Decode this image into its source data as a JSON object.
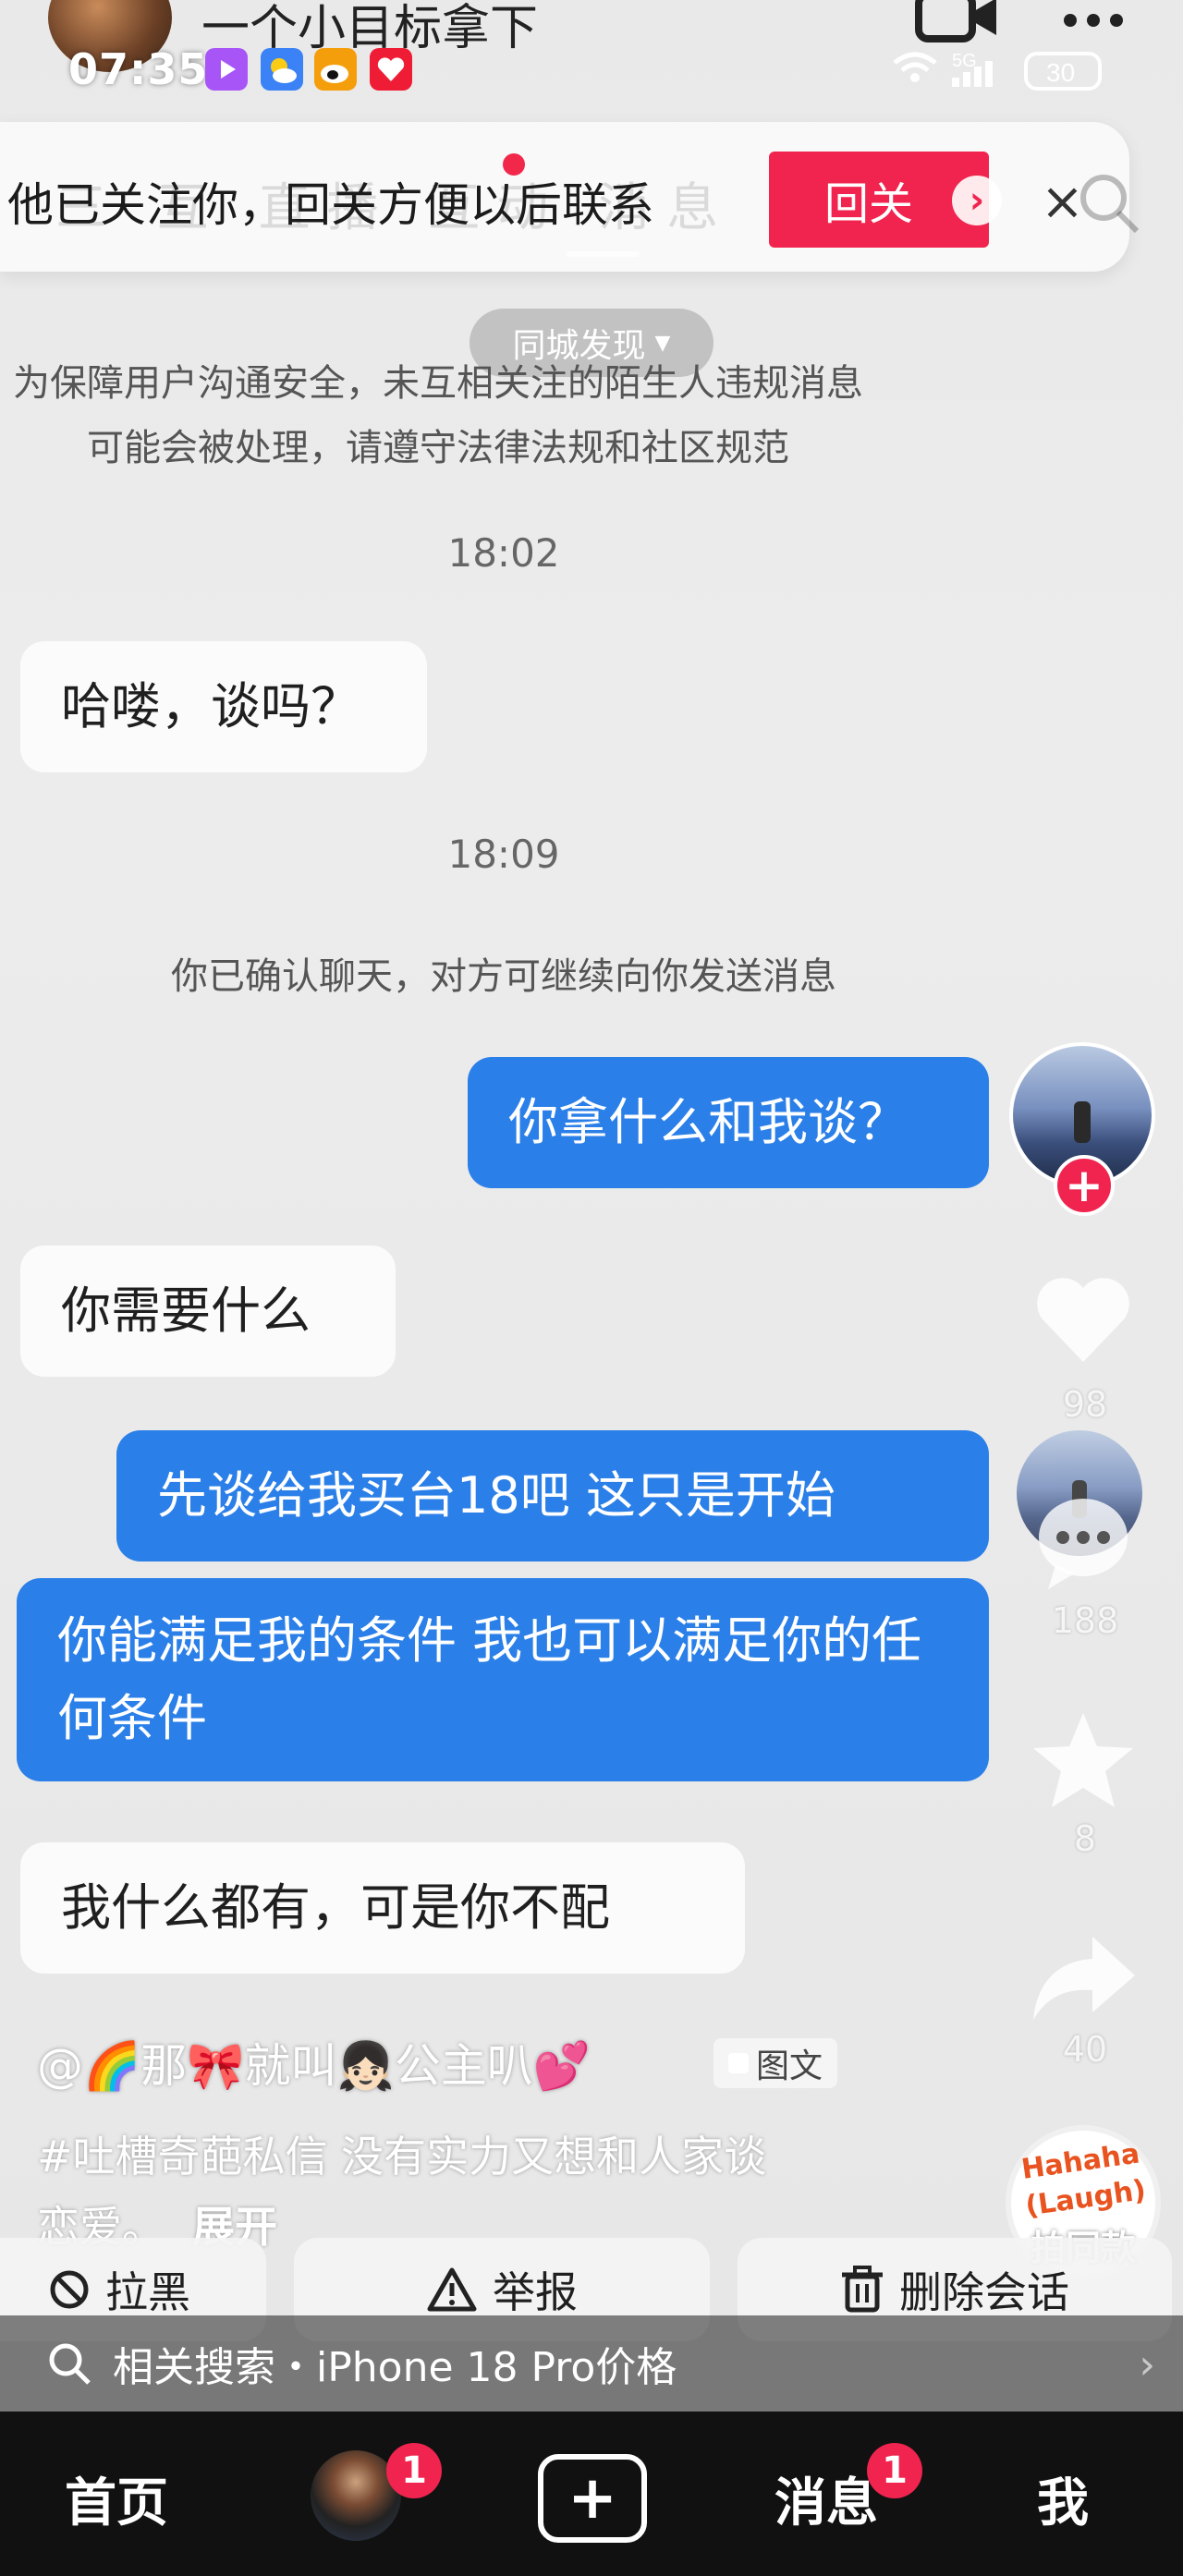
{
  "header": {
    "name": "一个小目标拿下",
    "video_icon": "video-camera-icon",
    "more_icon": "more-dots-icon"
  },
  "status_bar": {
    "time": "07:35",
    "network": "5G",
    "battery": "30",
    "apps": [
      {
        "icon": "video-app-icon",
        "color": "#a855f7"
      },
      {
        "icon": "weather-app-icon",
        "color": "#3b82f6"
      },
      {
        "icon": "weibo-icon",
        "color": "#f59e0b"
      },
      {
        "icon": "taobao-icon",
        "color": "#ef1c35"
      }
    ]
  },
  "banner": {
    "ghost_tabs": "三 互  直播  互动  消息  关注",
    "text": "他已关注你，回关方便以后联系",
    "follow_back_label": "回关",
    "arrow": "›",
    "close": "×"
  },
  "city_discover": "同城发现",
  "notice": "为保障用户沟通安全，未互相关注的陌生人违规消息可能会被处理，请遵守法律法规和社区规范",
  "times": {
    "t1": "18:02",
    "t2": "18:09"
  },
  "system_message": "你已确认聊天，对方可继续向你发送消息",
  "messages": [
    {
      "side": "in",
      "text": "哈喽，谈吗？"
    },
    {
      "side": "out",
      "text": "你拿什么和我谈？"
    },
    {
      "side": "in",
      "text": "你需要什么"
    },
    {
      "side": "out",
      "text": "先谈给我买台18吧 这只是开始"
    },
    {
      "side": "out",
      "text": "你能满足我的条件 我也可以满足你的任何条件"
    },
    {
      "side": "in",
      "text": "我什么都有，可是你不配"
    }
  ],
  "sidebar": {
    "likes": "98",
    "comments": "188",
    "favorites": "8",
    "shares": "40"
  },
  "caption": {
    "user": "@🌈那🎀就叫👧🏻公主叭💕",
    "tag": "图文",
    "line1": "#吐槽奇葩私信  没有实力又想和人家谈",
    "line2": "恋爱。",
    "expand": "展开"
  },
  "paisame": {
    "sticker": "Hahaha (Laugh)",
    "label": "拍同款"
  },
  "actions": {
    "block": "拉黑",
    "report": "举报",
    "delete": "删除会话"
  },
  "related_search": "相关搜索・iPhone 18 Pro价格",
  "nav": {
    "home": "首页",
    "friends_badge": "1",
    "messages": "消息",
    "messages_badge": "1",
    "me": "我",
    "add": "+"
  }
}
